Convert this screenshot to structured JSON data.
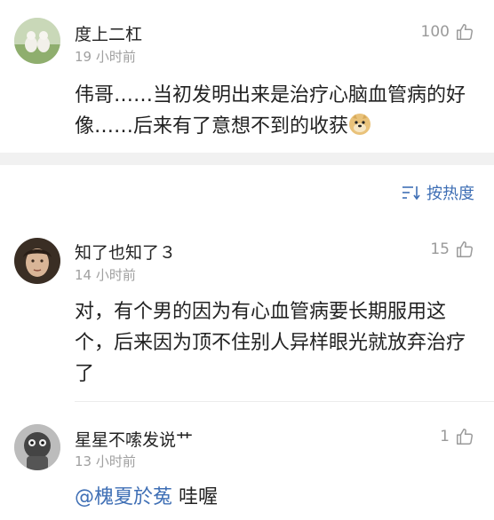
{
  "comments": [
    {
      "username": "度上二杠",
      "time": "19 小时前",
      "likes": "100",
      "text": "伟哥……当初发明出来是治疗心脑血管病的好像……后来有了意想不到的收获",
      "emoji": "doge-emoji-icon"
    },
    {
      "username": "知了也知了３",
      "time": "14 小时前",
      "likes": "15",
      "text": "对，有个男的因为有心血管病要长期服用这个，后来因为顶不住别人异样眼光就放弃治疗了"
    },
    {
      "username": "星星不嗦发说艹",
      "time": "13 小时前",
      "likes": "1",
      "mention": "@槐夏於菟",
      "text": " 哇喔"
    }
  ],
  "sort": {
    "label": "按热度",
    "icon": "sort-icon"
  },
  "colors": {
    "link": "#3f6fb5",
    "meta": "#a0a0a0",
    "band": "#f1f1f1"
  }
}
